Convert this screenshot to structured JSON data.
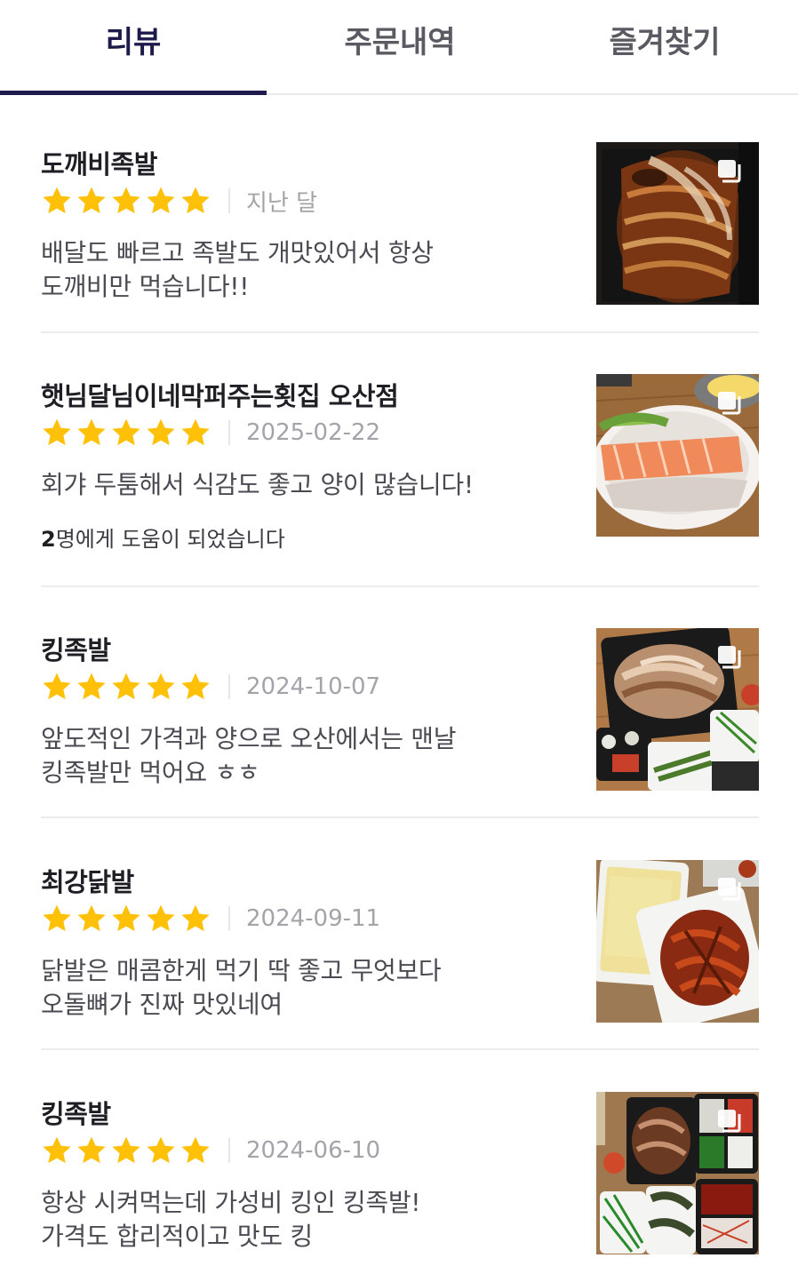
{
  "tabs": [
    {
      "label": "리뷰",
      "active": true
    },
    {
      "label": "주문내역",
      "active": false
    },
    {
      "label": "즐겨찾기",
      "active": false
    }
  ],
  "star_color": "#ffc107",
  "reviews": [
    {
      "store": "도깨비족발",
      "stars": 5,
      "date": "지난 달",
      "body": "배달도 빠르고 족발도 개맛있어서 항상\n도깨비만 먹습니다!!",
      "helpful_count": "",
      "helpful_text": "",
      "photo": "braised-pork-trotters"
    },
    {
      "store": "햇님달님이네막퍼주는횟집 오산점",
      "stars": 5,
      "date": "2025-02-22",
      "body": "회갸 두툼해서 식감도 좋고 양이 많습니다!",
      "helpful_count": "2",
      "helpful_text": "명에게 도움이 되었습니다",
      "photo": "sliced-raw-fish-platter"
    },
    {
      "store": "킹족발",
      "stars": 5,
      "date": "2024-10-07",
      "body": "앞도적인 가격과 양으로 오산에서는 맨날\n킹족발만 먹어요 ㅎㅎ",
      "helpful_count": "",
      "helpful_text": "",
      "photo": "pork-trotters-with-side-dishes"
    },
    {
      "store": "최강닭발",
      "stars": 5,
      "date": "2024-09-11",
      "body": "닭발은 매콤한게 먹기 딱 좋고 무엇보다\n오돌뼈가 진짜 맛있네여",
      "helpful_count": "",
      "helpful_text": "",
      "photo": "spicy-chicken-feet-and-egg"
    },
    {
      "store": "킹족발",
      "stars": 5,
      "date": "2024-06-10",
      "body": "항상 시켜먹는데 가성비 킹인 킹족발!\n가격도 합리적이고 맛도 킹",
      "helpful_count": "",
      "helpful_text": "",
      "photo": "pork-trotters-set-overhead"
    }
  ]
}
